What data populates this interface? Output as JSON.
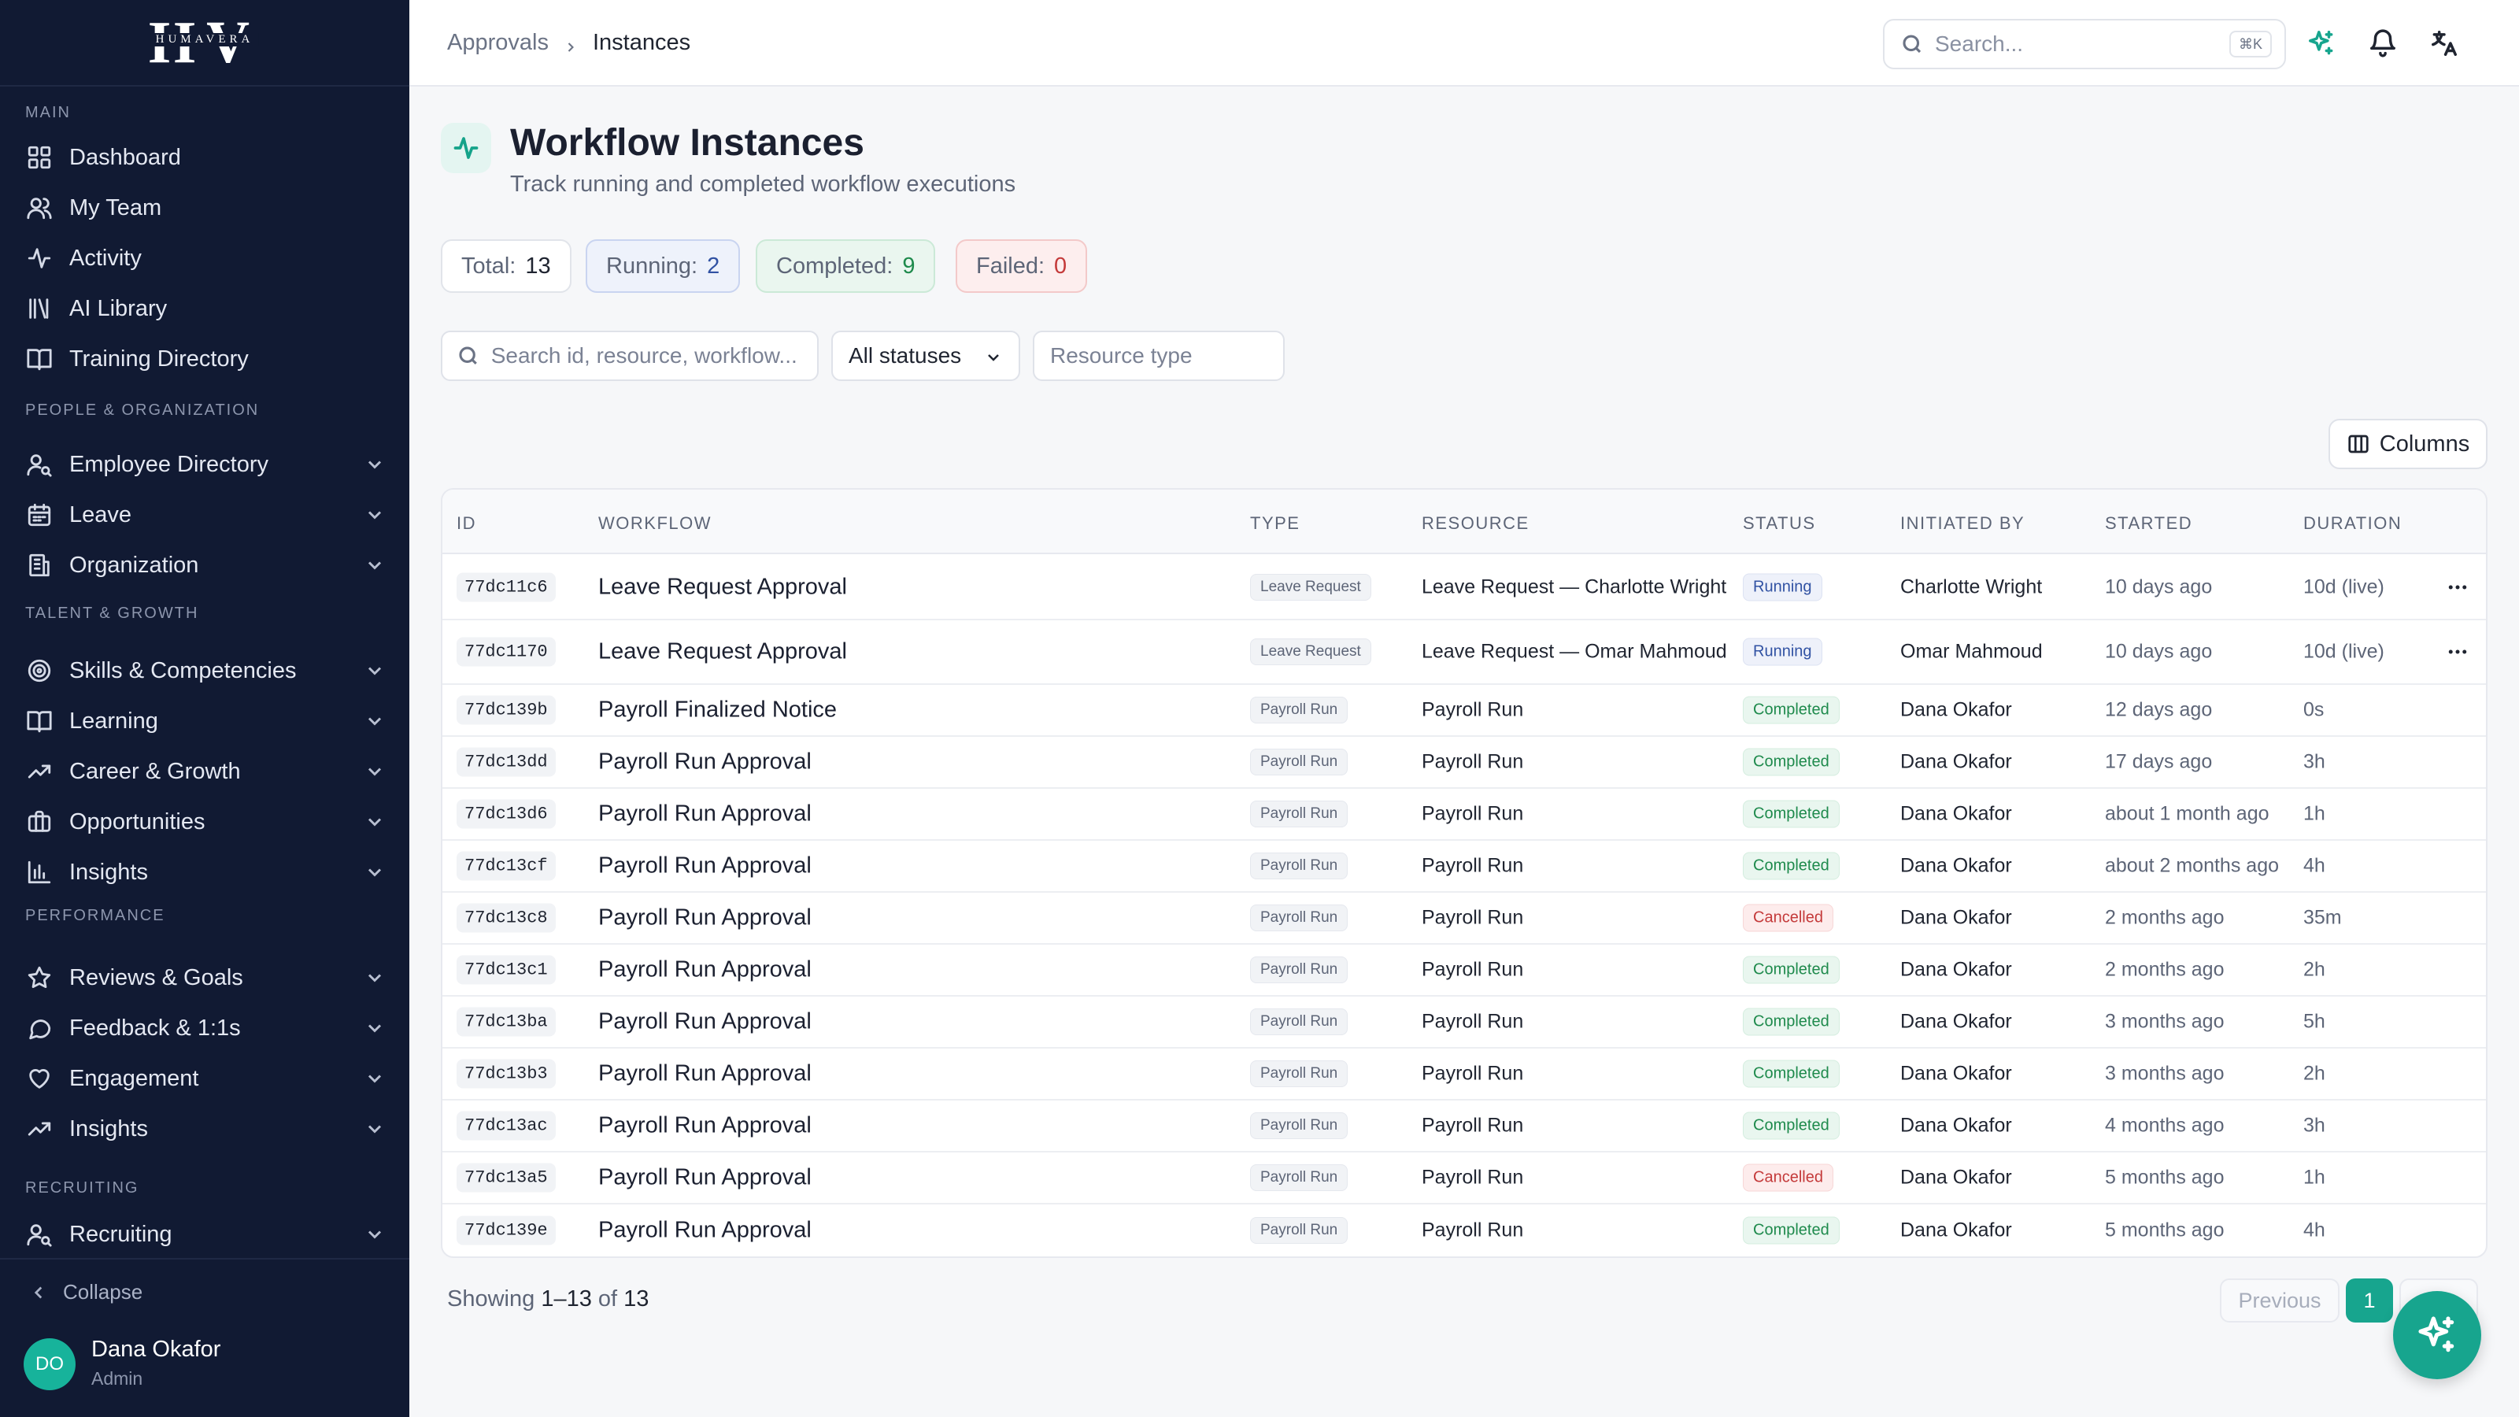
{
  "app": {
    "logo_letters": "HV",
    "logo_word": "HUMAVERA"
  },
  "sidebar": {
    "sections": [
      {
        "label": "MAIN"
      },
      {
        "label": "PEOPLE & ORGANIZATION"
      },
      {
        "label": "TALENT & GROWTH"
      },
      {
        "label": "PERFORMANCE"
      },
      {
        "label": "RECRUITING"
      }
    ],
    "items": [
      {
        "label": "Dashboard",
        "icon": "grid-icon"
      },
      {
        "label": "My Team",
        "icon": "users-icon"
      },
      {
        "label": "Activity",
        "icon": "activity-icon"
      },
      {
        "label": "AI Library",
        "icon": "library-icon"
      },
      {
        "label": "Training Directory",
        "icon": "book-icon"
      },
      {
        "label": "Employee Directory",
        "icon": "user-search-icon"
      },
      {
        "label": "Leave",
        "icon": "calendar-icon"
      },
      {
        "label": "Organization",
        "icon": "building-icon"
      },
      {
        "label": "Skills & Competencies",
        "icon": "target-icon"
      },
      {
        "label": "Learning",
        "icon": "book-icon"
      },
      {
        "label": "Career & Growth",
        "icon": "trending-up-icon"
      },
      {
        "label": "Opportunities",
        "icon": "briefcase-icon"
      },
      {
        "label": "Insights",
        "icon": "bar-chart-icon"
      },
      {
        "label": "Reviews & Goals",
        "icon": "star-icon"
      },
      {
        "label": "Feedback & 1:1s",
        "icon": "message-icon"
      },
      {
        "label": "Engagement",
        "icon": "heart-icon"
      },
      {
        "label": "Insights",
        "icon": "trending-up-icon"
      },
      {
        "label": "Recruiting",
        "icon": "user-search-icon"
      }
    ],
    "collapse_label": "Collapse",
    "user": {
      "initials": "DO",
      "name": "Dana Okafor",
      "role": "Admin"
    }
  },
  "header": {
    "breadcrumb": [
      "Approvals",
      "Instances"
    ],
    "search_placeholder": "Search...",
    "search_shortcut": "⌘K"
  },
  "page": {
    "title": "Workflow Instances",
    "subtitle": "Track running and completed workflow executions"
  },
  "stats": [
    {
      "label": "Total:",
      "value": "13"
    },
    {
      "label": "Running:",
      "value": "2"
    },
    {
      "label": "Completed:",
      "value": "9"
    },
    {
      "label": "Failed:",
      "value": "0"
    }
  ],
  "filters": {
    "search_placeholder": "Search id, resource, workflow...",
    "status_value": "All statuses",
    "resource_placeholder": "Resource type"
  },
  "columns_button": "Columns",
  "table": {
    "headers": [
      "ID",
      "WORKFLOW",
      "TYPE",
      "RESOURCE",
      "STATUS",
      "INITIATED BY",
      "STARTED",
      "DURATION"
    ],
    "rows": [
      {
        "id": "77dc11c6",
        "workflow": "Leave Request Approval",
        "type": "Leave Request",
        "resource": "Leave Request — Charlotte Wright",
        "status": "Running",
        "initiated_by": "Charlotte Wright",
        "started": "10 days ago",
        "duration": "10d (live)"
      },
      {
        "id": "77dc1170",
        "workflow": "Leave Request Approval",
        "type": "Leave Request",
        "resource": "Leave Request — Omar Mahmoud",
        "status": "Running",
        "initiated_by": "Omar Mahmoud",
        "started": "10 days ago",
        "duration": "10d (live)"
      },
      {
        "id": "77dc139b",
        "workflow": "Payroll Finalized Notice",
        "type": "Payroll Run",
        "resource": "Payroll Run",
        "status": "Completed",
        "initiated_by": "Dana Okafor",
        "started": "12 days ago",
        "duration": "0s"
      },
      {
        "id": "77dc13dd",
        "workflow": "Payroll Run Approval",
        "type": "Payroll Run",
        "resource": "Payroll Run",
        "status": "Completed",
        "initiated_by": "Dana Okafor",
        "started": "17 days ago",
        "duration": "3h"
      },
      {
        "id": "77dc13d6",
        "workflow": "Payroll Run Approval",
        "type": "Payroll Run",
        "resource": "Payroll Run",
        "status": "Completed",
        "initiated_by": "Dana Okafor",
        "started": "about 1 month ago",
        "duration": "1h"
      },
      {
        "id": "77dc13cf",
        "workflow": "Payroll Run Approval",
        "type": "Payroll Run",
        "resource": "Payroll Run",
        "status": "Completed",
        "initiated_by": "Dana Okafor",
        "started": "about 2 months ago",
        "duration": "4h"
      },
      {
        "id": "77dc13c8",
        "workflow": "Payroll Run Approval",
        "type": "Payroll Run",
        "resource": "Payroll Run",
        "status": "Cancelled",
        "initiated_by": "Dana Okafor",
        "started": "2 months ago",
        "duration": "35m"
      },
      {
        "id": "77dc13c1",
        "workflow": "Payroll Run Approval",
        "type": "Payroll Run",
        "resource": "Payroll Run",
        "status": "Completed",
        "initiated_by": "Dana Okafor",
        "started": "2 months ago",
        "duration": "2h"
      },
      {
        "id": "77dc13ba",
        "workflow": "Payroll Run Approval",
        "type": "Payroll Run",
        "resource": "Payroll Run",
        "status": "Completed",
        "initiated_by": "Dana Okafor",
        "started": "3 months ago",
        "duration": "5h"
      },
      {
        "id": "77dc13b3",
        "workflow": "Payroll Run Approval",
        "type": "Payroll Run",
        "resource": "Payroll Run",
        "status": "Completed",
        "initiated_by": "Dana Okafor",
        "started": "3 months ago",
        "duration": "2h"
      },
      {
        "id": "77dc13ac",
        "workflow": "Payroll Run Approval",
        "type": "Payroll Run",
        "resource": "Payroll Run",
        "status": "Completed",
        "initiated_by": "Dana Okafor",
        "started": "4 months ago",
        "duration": "3h"
      },
      {
        "id": "77dc13a5",
        "workflow": "Payroll Run Approval",
        "type": "Payroll Run",
        "resource": "Payroll Run",
        "status": "Cancelled",
        "initiated_by": "Dana Okafor",
        "started": "5 months ago",
        "duration": "1h"
      },
      {
        "id": "77dc139e",
        "workflow": "Payroll Run Approval",
        "type": "Payroll Run",
        "resource": "Payroll Run",
        "status": "Completed",
        "initiated_by": "Dana Okafor",
        "started": "5 months ago",
        "duration": "4h"
      }
    ]
  },
  "pagination": {
    "showing_prefix": "Showing",
    "range": "1–13",
    "of_word": "of",
    "total": "13",
    "previous_label": "Previous",
    "current_page": "1"
  },
  "colors": {
    "sidebar_bg": "#111a33",
    "accent": "#17a58e",
    "running_text": "#3152a3",
    "completed_text": "#1e8a4c",
    "cancelled_text": "#c43a3a"
  }
}
